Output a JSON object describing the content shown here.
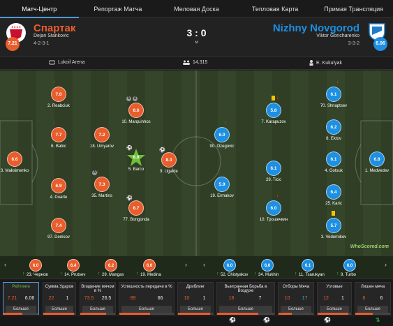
{
  "tabs": [
    "Матч-Центр",
    "Репортаж Матча",
    "Меловая Доска",
    "Тепловая Карта",
    "Примая Трансляция"
  ],
  "home": {
    "name": "Спартак",
    "coach": "Dejan Stankovic",
    "formation": "4-2-3-1",
    "rating": "7.21",
    "color": "#e95d2d",
    "crest_color": "#c8102e"
  },
  "away": {
    "name": "Nizhny Novgorod",
    "coach": "Viktor Goncharenko",
    "formation": "3-3-2",
    "rating": "6.06",
    "color": "#1e8fe1",
    "crest_color": "#1e7cc8"
  },
  "score": "3 : 0",
  "status": "м",
  "info": {
    "stadium": "Lukoil Arena",
    "attendance": "14,315",
    "referee": "E. Kukulyak"
  },
  "players_home": [
    {
      "num": "3",
      "name": "Maksimenko",
      "rating": "6.6"
    },
    {
      "num": "2",
      "name": "Reabciuk",
      "rating": "7.0",
      "arrow": "down"
    },
    {
      "num": "6",
      "name": "Babic",
      "rating": "7.7",
      "arrow": "down"
    },
    {
      "num": "4",
      "name": "Duarte",
      "rating": "6.9"
    },
    {
      "num": "97",
      "name": "Denisov",
      "rating": "7.4"
    },
    {
      "num": "18",
      "name": "Umyarov",
      "rating": "7.2"
    },
    {
      "num": "35",
      "name": "Martins",
      "rating": "7.3",
      "arrow": "down",
      "icon": "assist"
    },
    {
      "num": "10",
      "name": "Marquinhos",
      "rating": "8.6",
      "icon": "assists"
    },
    {
      "num": "5",
      "name": "Barco",
      "rating": "8.8",
      "star": true,
      "icon": "goal"
    },
    {
      "num": "77",
      "name": "Bongonda",
      "rating": "8.7",
      "arrow": "down",
      "icon": "goal"
    },
    {
      "num": "9",
      "name": "Ugalde",
      "rating": "8.3",
      "arrow": "down",
      "icon": "goal"
    }
  ],
  "players_away": [
    {
      "num": "1",
      "name": "Medvedev",
      "rating": "6.8"
    },
    {
      "num": "70",
      "name": "Shnaptsev",
      "rating": "6.1",
      "arrow": "down"
    },
    {
      "num": "8",
      "name": "Ektov",
      "rating": "6.2"
    },
    {
      "num": "4",
      "name": "Gotsuk",
      "rating": "6.1"
    },
    {
      "num": "25",
      "name": "Karic",
      "rating": "6.4"
    },
    {
      "num": "3",
      "name": "Vedernikov",
      "rating": "5.7",
      "icon": "yellow"
    },
    {
      "num": "7",
      "name": "Karapuzov",
      "rating": "5.8",
      "arrow": "down",
      "icon": "yellow"
    },
    {
      "num": "29",
      "name": "Ticic",
      "rating": "6.1"
    },
    {
      "num": "10",
      "name": "Трошечкин",
      "rating": "6.0",
      "arrow": "down"
    },
    {
      "num": "90",
      "name": "Ozegovic",
      "rating": "6.0",
      "arrow": "down"
    },
    {
      "num": "19",
      "name": "Ermakov",
      "rating": "5.9"
    }
  ],
  "watermark": "WhoScored.com",
  "subs_home": [
    {
      "num": "23",
      "name": "Чернов",
      "rating": "6.0"
    },
    {
      "num": "14",
      "name": "Prutsev",
      "rating": "6.4"
    },
    {
      "num": "29",
      "name": "Mangas",
      "rating": "6.2"
    },
    {
      "num": "19",
      "name": "Medina",
      "rating": "6.0"
    }
  ],
  "subs_away": [
    {
      "num": "52",
      "name": "Chistyakov",
      "rating": "6.0"
    },
    {
      "num": "34",
      "name": "Mukhin",
      "rating": "6.0"
    },
    {
      "num": "11",
      "name": "Tsarukyan",
      "rating": "6.1"
    },
    {
      "num": "9",
      "name": "Turbo",
      "rating": "6.0"
    }
  ],
  "stats": [
    {
      "title": "Рейтинги",
      "home": "7.21",
      "away": "6.06",
      "more": "Больше",
      "share": 0.54
    },
    {
      "title": "Сумма Ударов",
      "home": "22",
      "away": "1",
      "more": "Больше",
      "share": 0.96
    },
    {
      "title": "Владение мячом в %",
      "home": "73.5",
      "away": "26.5",
      "more": "Больше",
      "share": 0.735
    },
    {
      "title": "Успешность передачи в %",
      "home": "89",
      "away": "66",
      "more": "Больше",
      "share": 0.57
    },
    {
      "title": "Дриблинг",
      "home": "10",
      "away": "1",
      "more": "Больше",
      "share": 0.91
    },
    {
      "title": "Выигранная Борьба в Воздухе",
      "home": "18",
      "away": "7",
      "more": "Больше",
      "share": 0.72
    },
    {
      "title": "Отборы Мяча",
      "home": "10",
      "away": "17",
      "more": "Больше",
      "share": 0.37
    },
    {
      "title": "Угловые",
      "home": "12",
      "away": "1",
      "more": "Больше",
      "share": 0.92
    },
    {
      "title": "Лишен мяча",
      "home": "6",
      "away": "6",
      "more": "Больше",
      "share": 0.5
    }
  ]
}
